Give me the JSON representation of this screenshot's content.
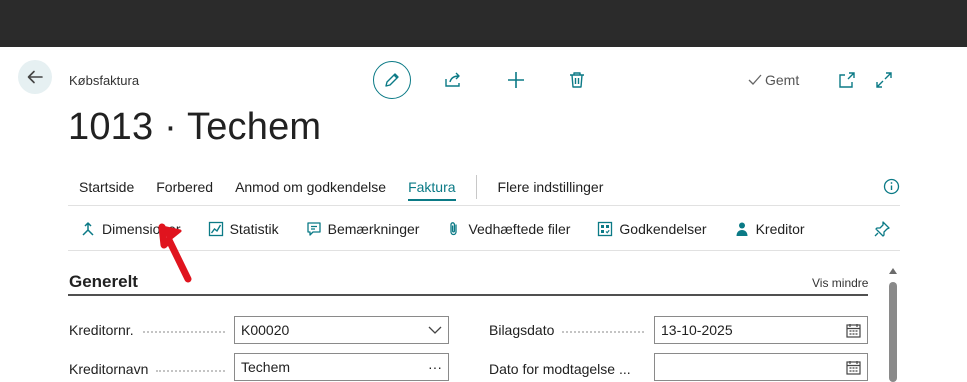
{
  "header": {
    "breadcrumb": "Købsfaktura",
    "title": "1013 · Techem",
    "saved_label": "Gemt"
  },
  "tabs": [
    {
      "label": "Startside"
    },
    {
      "label": "Forbered"
    },
    {
      "label": "Anmod om godkendelse"
    },
    {
      "label": "Faktura"
    },
    {
      "label": "Flere indstillinger"
    }
  ],
  "actions": [
    {
      "label": "Dimensioner",
      "icon": "dimensions-icon"
    },
    {
      "label": "Statistik",
      "icon": "statistics-icon"
    },
    {
      "label": "Bemærkninger",
      "icon": "comments-icon"
    },
    {
      "label": "Vedhæftede filer",
      "icon": "paperclip-icon"
    },
    {
      "label": "Godkendelser",
      "icon": "approvals-icon"
    },
    {
      "label": "Kreditor",
      "icon": "person-icon"
    }
  ],
  "section": {
    "title": "Generelt",
    "toggle_label": "Vis mindre"
  },
  "fields": {
    "vendor_no": {
      "label": "Kreditornr.",
      "value": "K00020"
    },
    "vendor_name": {
      "label": "Kreditornavn",
      "value": "Techem",
      "suffix": "···"
    },
    "document_date": {
      "label": "Bilagsdato",
      "value": "13-10-2025"
    },
    "received_date": {
      "label": "Dato for modtagelse ...",
      "value": ""
    }
  },
  "colors": {
    "accent": "#0b7a86",
    "topbar": "#2b2b2b",
    "annotation_arrow": "#e0141e"
  }
}
